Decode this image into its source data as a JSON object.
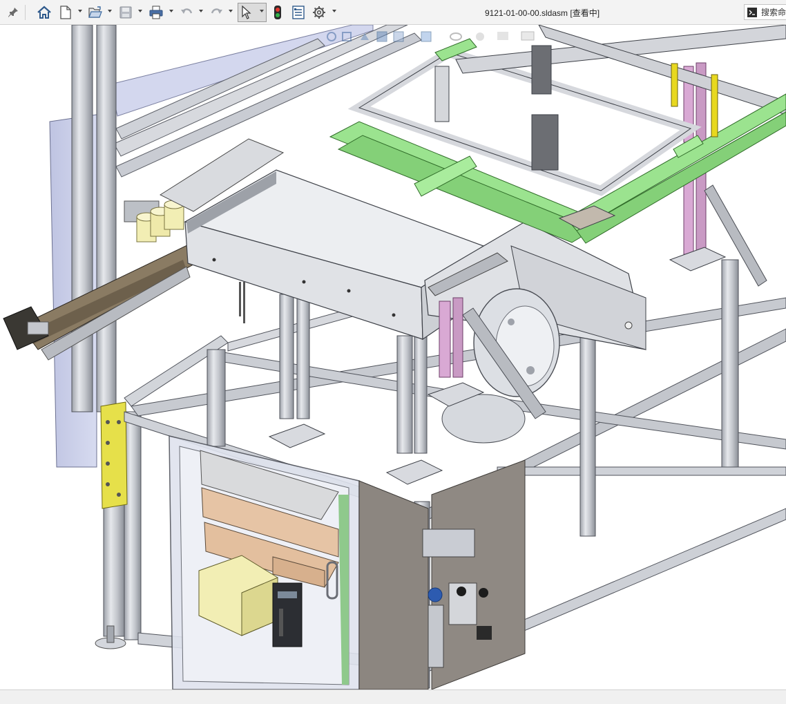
{
  "window": {
    "title": "9121-01-00-00.sldasm [查看中]"
  },
  "toolbar": {
    "items": [
      {
        "name": "pin-icon"
      },
      {
        "name": "home-icon"
      },
      {
        "name": "new-document-icon"
      },
      {
        "name": "open-icon"
      },
      {
        "name": "save-icon"
      },
      {
        "name": "print-icon"
      },
      {
        "name": "undo-icon"
      },
      {
        "name": "redo-icon"
      },
      {
        "name": "select-pointer-icon"
      },
      {
        "name": "rebuild-traffic-light-icon"
      },
      {
        "name": "file-properties-icon"
      },
      {
        "name": "options-gear-icon"
      }
    ]
  },
  "search": {
    "label": "搜索命"
  },
  "heads_up_view": {
    "items": [
      "zoom-to-fit-icon",
      "zoom-area-icon",
      "previous-view-icon",
      "section-view-icon",
      "view-orientation-icon",
      "display-style-icon",
      "hide-show-icon",
      "edit-appearance-icon",
      "apply-scene-icon",
      "view-settings-icon"
    ]
  },
  "colors": {
    "toolbar_bg": "#f3f3f3",
    "frame_aluminum": "#c9ccd3",
    "frame_edge": "#5a5d63",
    "green_rail": "#9be38f",
    "yellow_plate": "#e6e04a",
    "pink_rail": "#d9a9d4",
    "panel_grey": "#8c8680",
    "cream_box": "#f2eeb4",
    "tan_box": "#e6c4a5",
    "wall_blue": "#c8cde8"
  }
}
